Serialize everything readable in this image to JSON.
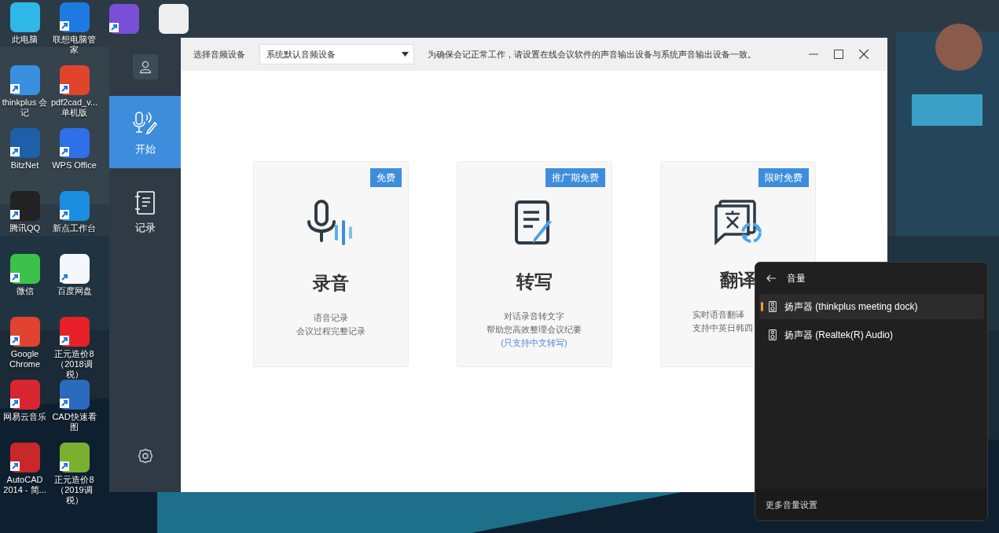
{
  "desktop": {
    "shortcuts": [
      {
        "label": "此电脑",
        "color": "#2fb7e8",
        "shortcut": false
      },
      {
        "label": "thinkplus 会记",
        "color": "#3b8fe0",
        "shortcut": true
      },
      {
        "label": "BitzNet",
        "color": "#1d5fa8",
        "shortcut": true
      },
      {
        "label": "腾讯QQ",
        "color": "#222222",
        "shortcut": true
      },
      {
        "label": "微信",
        "color": "#3cc24a",
        "shortcut": true
      },
      {
        "label": "Google Chrome",
        "color": "#e0432f",
        "shortcut": true
      },
      {
        "label": "网易云音乐",
        "color": "#d9252f",
        "shortcut": true
      },
      {
        "label": "AutoCAD 2014 - 简...",
        "color": "#c8282a",
        "shortcut": true
      },
      {
        "label": "联想电脑管家",
        "color": "#1e7ae0",
        "shortcut": true
      },
      {
        "label": "pdf2cad_v... 单机版",
        "color": "#e0452b",
        "shortcut": true
      },
      {
        "label": "WPS Office",
        "color": "#2f6fe8",
        "shortcut": true
      },
      {
        "label": "新点工作台",
        "color": "#1a8ee0",
        "shortcut": true
      },
      {
        "label": "百度网盘",
        "color": "#f4f7fb",
        "shortcut": true
      },
      {
        "label": "正元造价8（2018调税）",
        "color": "#e8202a",
        "shortcut": true
      },
      {
        "label": "CAD快速看图",
        "color": "#2a6bbd",
        "shortcut": true
      },
      {
        "label": "正元造价8（2019调税）",
        "color": "#7ab030",
        "shortcut": true
      }
    ],
    "partial_shortcuts": [
      {
        "color": "#7a4fd8",
        "shortcut": true
      },
      {
        "color": "#eeeeee",
        "shortcut": false
      }
    ]
  },
  "app": {
    "sidebar": {
      "items": [
        {
          "kind": "start",
          "label": "开始",
          "selected": true
        },
        {
          "kind": "records",
          "label": "记录",
          "selected": false
        }
      ]
    },
    "toolbar": {
      "device_label": "选择音频设备",
      "device_value": "系统默认音频设备",
      "notice": "为确保会记正常工作，请设置在线会议软件的声音输出设备与系统声音输出设备一致。"
    },
    "cards": [
      {
        "kind": "record",
        "badge": "免费",
        "title": "录音",
        "lines": [
          "语音记录",
          "会议过程完整记录"
        ],
        "partly_covered": false
      },
      {
        "kind": "transcribe",
        "badge": "推广期免费",
        "title": "转写",
        "lines": [
          "对话录音转文字",
          "帮助您高效整理会议纪要"
        ],
        "note": "(只支持中文转写)",
        "partly_covered": false
      },
      {
        "kind": "translate",
        "badge": "限时免费",
        "title": "翻译",
        "lines": [
          "实时语音翻译",
          "支持中英日韩四"
        ],
        "partly_covered": true
      }
    ]
  },
  "volume_flyout": {
    "title": "音量",
    "devices": [
      {
        "label": "扬声器 (thinkplus meeting dock)",
        "selected": true
      },
      {
        "label": "扬声器 (Realtek(R) Audio)",
        "selected": false
      }
    ],
    "footer": "更多音量设置"
  }
}
